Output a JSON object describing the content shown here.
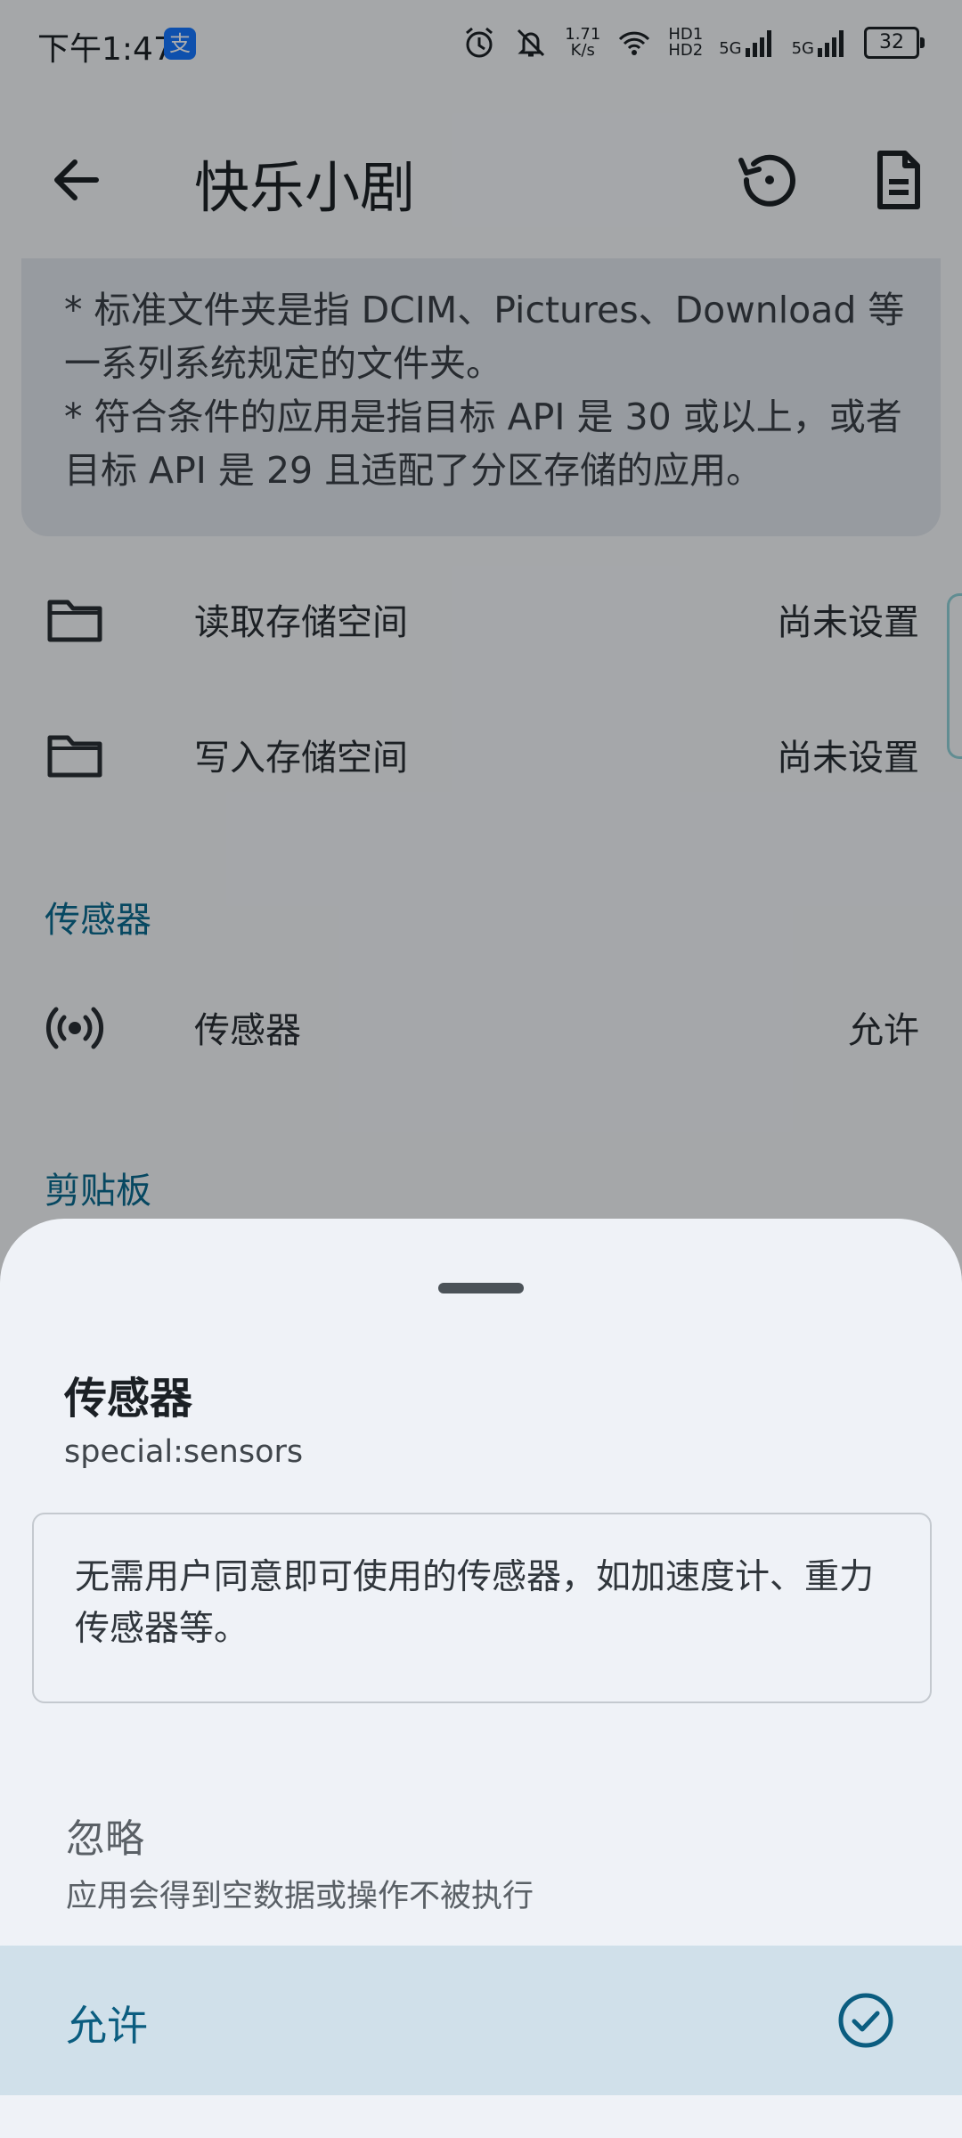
{
  "status_bar": {
    "time": "下午1:47",
    "alipay_badge": "支",
    "net_speed_value": "1.71",
    "net_speed_unit": "K/s",
    "hd1": "HD1",
    "hd2": "HD2",
    "sim1_type": "5G",
    "sim2_type": "5G",
    "battery": "32"
  },
  "app_bar": {
    "title": "快乐小剧",
    "back_icon": "arrow-back-icon",
    "history_icon": "history-icon",
    "document_icon": "document-icon"
  },
  "note": {
    "line1": "* 标准文件夹是指 DCIM、Pictures、Download 等一系列系统规定的文件夹。",
    "line2": "* 符合条件的应用是指目标 API 是 30 或以上，或者目标 API 是 29 且适配了分区存储的应用。"
  },
  "permissions": [
    {
      "icon": "folder-icon",
      "label": "读取存储空间",
      "value": "尚未设置"
    },
    {
      "icon": "folder-icon",
      "label": "写入存储空间",
      "value": "尚未设置"
    }
  ],
  "sections": {
    "sensors": "传感器",
    "clipboard": "剪贴板"
  },
  "sensor_row": {
    "icon": "sensors-icon",
    "label": "传感器",
    "value": "允许"
  },
  "sheet": {
    "title": "传感器",
    "subtitle": "special:sensors",
    "description": "无需用户同意即可使用的传感器，如加速度计、重力传感器等。",
    "options": [
      {
        "title": "忽略",
        "subtitle": "应用会得到空数据或操作不被执行",
        "selected": false
      },
      {
        "title": "允许",
        "selected": true
      }
    ]
  },
  "colors": {
    "accent": "#0b6b90",
    "selected_bg": "#d0e0ea",
    "scrim": "rgba(0,0,0,0.32)"
  }
}
